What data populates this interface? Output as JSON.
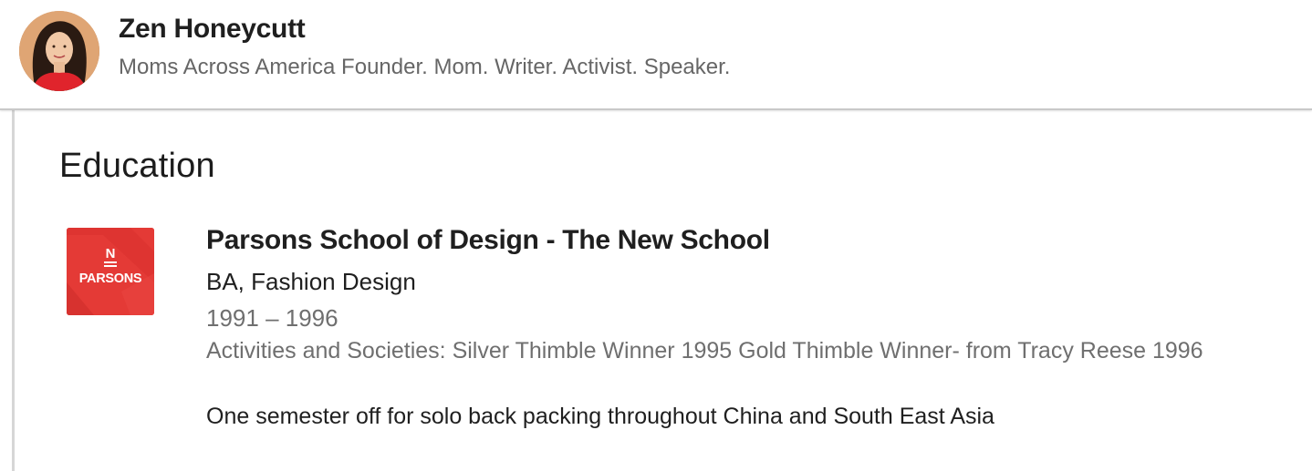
{
  "profile": {
    "name": "Zen Honeycutt",
    "headline": "Moms Across America Founder. Mom. Writer. Activist. Speaker.",
    "avatar_icon": "profile-photo"
  },
  "education": {
    "section_title": "Education",
    "entries": [
      {
        "school": "Parsons School of Design - The New School",
        "logo_text": "PARSONS",
        "logo_mark": "N",
        "logo_color": "#e43a36",
        "degree": "BA, Fashion Design",
        "dates": "1991 – 1996",
        "activities": "Activities and Societies: Silver Thimble Winner 1995 Gold Thimble Winner- from Tracy Reese 1996",
        "description": "One semester off for solo back packing throughout China and South East Asia"
      }
    ]
  }
}
